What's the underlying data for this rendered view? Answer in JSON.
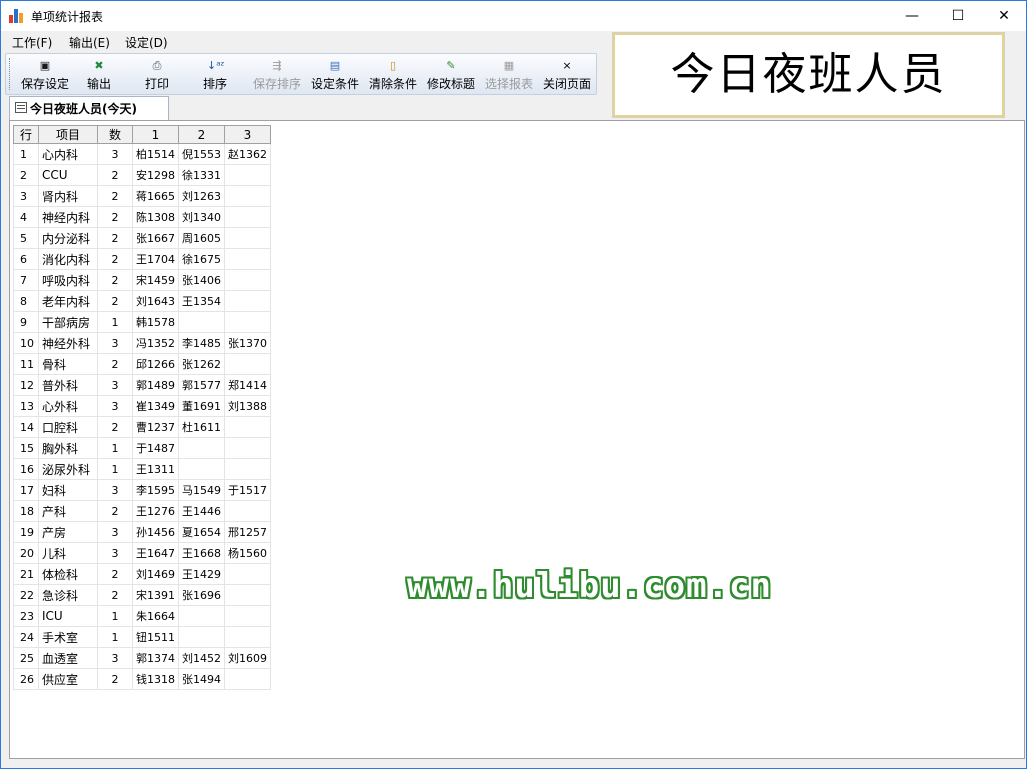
{
  "window": {
    "title": "单项统计报表",
    "minimize_glyph": "—",
    "maximize_glyph": "☐",
    "close_glyph": "✕"
  },
  "menu": {
    "items": [
      "工作(F)",
      "输出(E)",
      "设定(D)"
    ]
  },
  "toolbar": {
    "buttons": [
      {
        "label": "保存设定",
        "icon": "save-icon",
        "glyph": "▣",
        "color": "#1a1a1a",
        "enabled": true
      },
      {
        "label": "输出",
        "icon": "excel-icon",
        "glyph": "✖",
        "color": "#1e8a3a",
        "enabled": true
      },
      {
        "label": "打印",
        "icon": "printer-icon",
        "glyph": "⎙",
        "color": "#4a5a70",
        "enabled": true
      },
      {
        "label": "排序",
        "icon": "sort-az-icon",
        "glyph": "↓ᵃᶻ",
        "color": "#2050a0",
        "enabled": true
      },
      {
        "label": "保存排序",
        "icon": "save-sort-icon",
        "glyph": "⇶",
        "color": "#9a9a9a",
        "enabled": false
      },
      {
        "label": "设定条件",
        "icon": "filter-icon",
        "glyph": "▤",
        "color": "#3a70c0",
        "enabled": true
      },
      {
        "label": "清除条件",
        "icon": "clear-filter-icon",
        "glyph": "▯",
        "color": "#c09020",
        "enabled": true
      },
      {
        "label": "修改标题",
        "icon": "edit-title-icon",
        "glyph": "✎",
        "color": "#2e8b2e",
        "enabled": true
      },
      {
        "label": "选择报表",
        "icon": "select-report-icon",
        "glyph": "▦",
        "color": "#9a9a9a",
        "enabled": false
      },
      {
        "label": "关闭页面",
        "icon": "close-page-icon",
        "glyph": "×",
        "color": "#000000",
        "enabled": true
      }
    ]
  },
  "headline": "今日夜班人员",
  "tab": {
    "label": "今日夜班人员(今天)"
  },
  "grid": {
    "headers": [
      "行",
      "项目",
      "数",
      "1",
      "2",
      "3"
    ],
    "rows": [
      [
        "1",
        "心内科",
        "3",
        "柏1514",
        "倪1553",
        "赵1362"
      ],
      [
        "2",
        "CCU",
        "2",
        "安1298",
        "徐1331",
        ""
      ],
      [
        "3",
        "肾内科",
        "2",
        "蒋1665",
        "刘1263",
        ""
      ],
      [
        "4",
        "神经内科",
        "2",
        "陈1308",
        "刘1340",
        ""
      ],
      [
        "5",
        "内分泌科",
        "2",
        "张1667",
        "周1605",
        ""
      ],
      [
        "6",
        "消化内科",
        "2",
        "王1704",
        "徐1675",
        ""
      ],
      [
        "7",
        "呼吸内科",
        "2",
        "宋1459",
        "张1406",
        ""
      ],
      [
        "8",
        "老年内科",
        "2",
        "刘1643",
        "王1354",
        ""
      ],
      [
        "9",
        "干部病房",
        "1",
        "韩1578",
        "",
        ""
      ],
      [
        "10",
        "神经外科",
        "3",
        "冯1352",
        "李1485",
        "张1370"
      ],
      [
        "11",
        "骨科",
        "2",
        "邱1266",
        "张1262",
        ""
      ],
      [
        "12",
        "普外科",
        "3",
        "郭1489",
        "郭1577",
        "郑1414"
      ],
      [
        "13",
        "心外科",
        "3",
        "崔1349",
        "董1691",
        "刘1388"
      ],
      [
        "14",
        "口腔科",
        "2",
        "曹1237",
        "杜1611",
        ""
      ],
      [
        "15",
        "胸外科",
        "1",
        "于1487",
        "",
        ""
      ],
      [
        "16",
        "泌尿外科",
        "1",
        "王1311",
        "",
        ""
      ],
      [
        "17",
        "妇科",
        "3",
        "李1595",
        "马1549",
        "于1517"
      ],
      [
        "18",
        "产科",
        "2",
        "王1276",
        "王1446",
        ""
      ],
      [
        "19",
        "产房",
        "3",
        "孙1456",
        "夏1654",
        "邢1257"
      ],
      [
        "20",
        "儿科",
        "3",
        "王1647",
        "王1668",
        "杨1560"
      ],
      [
        "21",
        "体检科",
        "2",
        "刘1469",
        "王1429",
        ""
      ],
      [
        "22",
        "急诊科",
        "2",
        "宋1391",
        "张1696",
        ""
      ],
      [
        "23",
        "ICU",
        "1",
        "朱1664",
        "",
        ""
      ],
      [
        "24",
        "手术室",
        "1",
        "钮1511",
        "",
        ""
      ],
      [
        "25",
        "血透室",
        "3",
        "郭1374",
        "刘1452",
        "刘1609"
      ],
      [
        "26",
        "供应室",
        "2",
        "钱1318",
        "张1494",
        ""
      ]
    ]
  },
  "watermark": "www.hulibu.com.cn"
}
